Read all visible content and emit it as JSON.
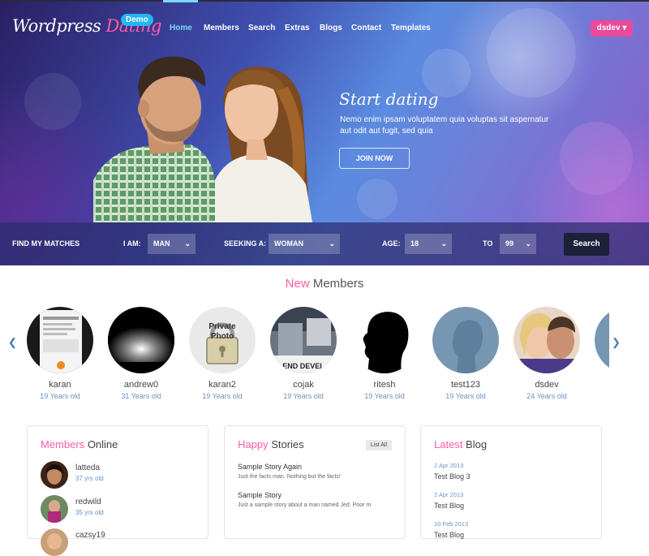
{
  "brand": {
    "logo_part1": "Wordpress",
    "logo_part2": "Dating",
    "badge": "Demo"
  },
  "nav": {
    "items": [
      "Home",
      "Members",
      "Search",
      "Extras",
      "Blogs",
      "Contact",
      "Templates"
    ],
    "active": "Home"
  },
  "user_menu": {
    "label": "dsdev",
    "icon": "caret-down-icon"
  },
  "hero": {
    "tagline": "Start dating",
    "text": "Nemo enim ipsam voluptatem quia voluptas sit aspernatur aut odit aut fugit, sed quia",
    "button": "JOIN NOW"
  },
  "search": {
    "heading": "FIND MY MATCHES",
    "i_am_label": "I AM:",
    "i_am_value": "MAN",
    "seeking_label": "SEEKING A:",
    "seeking_value": "WOMAN",
    "age_label": "AGE:",
    "age_from": "18",
    "to_label": "TO",
    "age_to": "99",
    "button": "Search"
  },
  "new_members": {
    "title_highlight": "New",
    "title_rest": "Members",
    "prev_icon": "chevron-left-icon",
    "next_icon": "chevron-right-icon",
    "members": [
      {
        "name": "karan",
        "age": "19 Years old"
      },
      {
        "name": "andrew0",
        "age": "31 Years old"
      },
      {
        "name": "karan2",
        "age": "19 Years old",
        "photo_text_1": "Private",
        "photo_text_2": "Photo"
      },
      {
        "name": "cojak",
        "age": "19 Years old",
        "photo_text": "END DEVEL"
      },
      {
        "name": "ritesh",
        "age": "19 Years old"
      },
      {
        "name": "test123",
        "age": "19 Years old"
      },
      {
        "name": "dsdev",
        "age": "24 Years old"
      }
    ]
  },
  "members_online": {
    "title_highlight": "Members",
    "title_rest": "Online",
    "items": [
      {
        "name": "latteda",
        "age": "37 yrs old"
      },
      {
        "name": "redwild",
        "age": "35 yrs old"
      },
      {
        "name": "cazsy19",
        "age": ""
      }
    ]
  },
  "happy_stories": {
    "title_highlight": "Happy",
    "title_rest": "Stories",
    "list_all": "List All",
    "items": [
      {
        "title": "Sample Story Again",
        "text": "Just the facts man. Nothing but the facts!"
      },
      {
        "title": "Sample Story",
        "text": "Just a sample story about a man named Jed. Poor m"
      }
    ]
  },
  "latest_blog": {
    "title_highlight": "Latest",
    "title_rest": "Blog",
    "items": [
      {
        "date": "2 Apr 2013",
        "title": "Test Blog 3"
      },
      {
        "date": "2 Apr 2013",
        "title": "Test Blog"
      },
      {
        "date": "10 Feb 2013",
        "title": "Test Blog"
      }
    ]
  },
  "colors": {
    "accent_pink": "#ff5ba8",
    "accent_blue": "#7fd7ff",
    "button_dark": "#1c2038",
    "badge_blue": "#22b7f0",
    "user_btn": "#e94a9a"
  }
}
